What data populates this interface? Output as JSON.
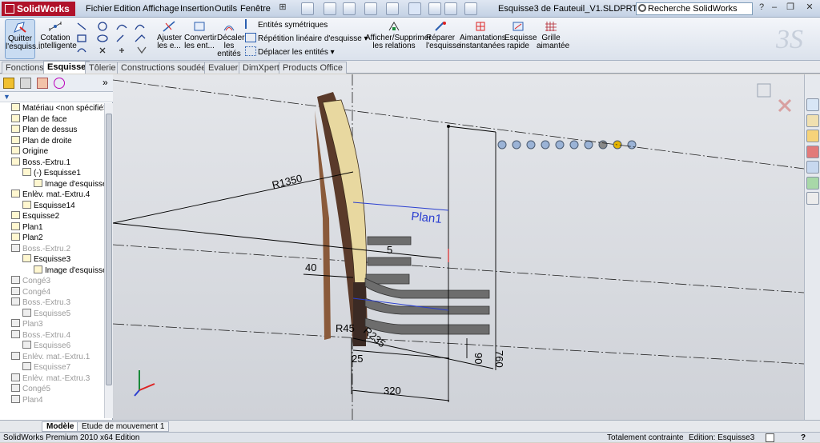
{
  "app": {
    "name": "SolidWorks",
    "doc_title": "Esquisse3 de Fauteuil_V1.SLDPRT *"
  },
  "menu": [
    "Fichier",
    "Edition",
    "Affichage",
    "Insertion",
    "Outils",
    "Fenêtre"
  ],
  "search": {
    "placeholder": "Recherche SolidWorks"
  },
  "commands": {
    "quit_sketch": "Quitter l'esquiss...",
    "smart_dim": "Cotation intelligente",
    "trim": "Ajuster les e...",
    "convert": "Convertir les ent...",
    "offset": "Décaler les entités",
    "mirror": "Entités symétriques",
    "linear_pattern": "Répétition linéaire d'esquisse",
    "move": "Déplacer les entités",
    "relations": "Afficher/Supprimer les relations",
    "repair": "Réparer l'esquisse",
    "snaps": "Aimantations instantanées",
    "quick_sketch": "Esquisse rapide",
    "grid": "Grille aimantée"
  },
  "tabs": [
    "Fonctions",
    "Esquisse",
    "Tôlerie",
    "Constructions soudées",
    "Evaluer",
    "DimXpert",
    "Products Office"
  ],
  "active_tab": "Esquisse",
  "tree": [
    {
      "label": "Matériau <non spécifié>",
      "indent": 0,
      "gray": false,
      "icon": "material-icon"
    },
    {
      "label": "Plan de face",
      "indent": 0,
      "gray": false,
      "icon": "plane-icon"
    },
    {
      "label": "Plan de dessus",
      "indent": 0,
      "gray": false,
      "icon": "plane-icon"
    },
    {
      "label": "Plan de droite",
      "indent": 0,
      "gray": false,
      "icon": "plane-icon"
    },
    {
      "label": "Origine",
      "indent": 0,
      "gray": false,
      "icon": "origin-icon"
    },
    {
      "label": "Boss.-Extru.1",
      "indent": 0,
      "gray": false,
      "icon": "boss-icon"
    },
    {
      "label": "(-) Esquisse1",
      "indent": 1,
      "gray": false,
      "icon": "sketch-icon"
    },
    {
      "label": "Image d'esquisse1",
      "indent": 2,
      "gray": false,
      "icon": "image-icon"
    },
    {
      "label": "Enlèv. mat.-Extru.4",
      "indent": 0,
      "gray": false,
      "icon": "cut-icon"
    },
    {
      "label": "Esquisse14",
      "indent": 1,
      "gray": false,
      "icon": "sketch-icon"
    },
    {
      "label": "Esquisse2",
      "indent": 0,
      "gray": false,
      "icon": "sketch-icon"
    },
    {
      "label": "Plan1",
      "indent": 0,
      "gray": false,
      "icon": "plane-icon"
    },
    {
      "label": "Plan2",
      "indent": 0,
      "gray": false,
      "icon": "plane-icon"
    },
    {
      "label": "Boss.-Extru.2",
      "indent": 0,
      "gray": true,
      "icon": "boss-icon"
    },
    {
      "label": "Esquisse3",
      "indent": 1,
      "gray": false,
      "icon": "sketch-icon"
    },
    {
      "label": "Image d'esquisse2",
      "indent": 2,
      "gray": false,
      "icon": "image-icon"
    },
    {
      "label": "Congé3",
      "indent": 0,
      "gray": true,
      "icon": "fillet-icon"
    },
    {
      "label": "Congé4",
      "indent": 0,
      "gray": true,
      "icon": "fillet-icon"
    },
    {
      "label": "Boss.-Extru.3",
      "indent": 0,
      "gray": true,
      "icon": "boss-icon"
    },
    {
      "label": "Esquisse5",
      "indent": 1,
      "gray": true,
      "icon": "sketch-icon"
    },
    {
      "label": "Plan3",
      "indent": 0,
      "gray": true,
      "icon": "plane-icon"
    },
    {
      "label": "Boss.-Extru.4",
      "indent": 0,
      "gray": true,
      "icon": "boss-icon"
    },
    {
      "label": "Esquisse6",
      "indent": 1,
      "gray": true,
      "icon": "sketch-icon"
    },
    {
      "label": "Enlèv. mat.-Extru.1",
      "indent": 0,
      "gray": true,
      "icon": "cut-icon"
    },
    {
      "label": "Esquisse7",
      "indent": 1,
      "gray": true,
      "icon": "sketch-icon"
    },
    {
      "label": "Enlèv. mat.-Extru.3",
      "indent": 0,
      "gray": true,
      "icon": "cut-icon"
    },
    {
      "label": "Congé5",
      "indent": 0,
      "gray": true,
      "icon": "fillet-icon"
    },
    {
      "label": "Plan4",
      "indent": 0,
      "gray": true,
      "icon": "plane-icon"
    }
  ],
  "sketch": {
    "dims": {
      "r1350": "R1350",
      "d40": "40",
      "d5": "5",
      "r45": "R45",
      "r235": "R235",
      "d25": "25",
      "d320": "320",
      "d90": "90",
      "d760": "760"
    },
    "plane_label": "Plan1"
  },
  "bottom_tabs": [
    "Modèle",
    "Etude de mouvement 1"
  ],
  "status": {
    "product": "SolidWorks Premium 2010 x64 Edition",
    "constraint": "Totalement contrainte",
    "editing": "Edition: Esquisse3"
  },
  "colors": {
    "accent": "#b0122a",
    "plane": "#2b3fd0",
    "chair_light": "#e8d8a0",
    "chair_dark": "#5a3a2a"
  }
}
